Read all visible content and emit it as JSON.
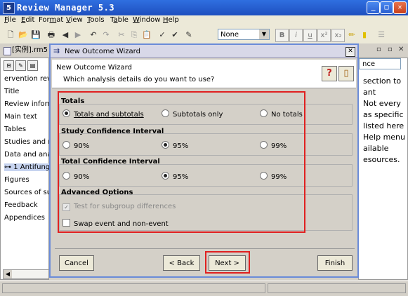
{
  "app": {
    "title": "Review Manager 5.3",
    "icon_text": "5",
    "window_controls": [
      "minimize-icon",
      "maximize-icon",
      "close-icon"
    ]
  },
  "menu": [
    {
      "label": "File",
      "mnemonic": "F"
    },
    {
      "label": "Edit",
      "mnemonic": "E"
    },
    {
      "label": "Format",
      "mnemonic": "m"
    },
    {
      "label": "View",
      "mnemonic": "V"
    },
    {
      "label": "Tools",
      "mnemonic": "T"
    },
    {
      "label": "Table",
      "mnemonic": "a"
    },
    {
      "label": "Window",
      "mnemonic": "W"
    },
    {
      "label": "Help",
      "mnemonic": "H"
    }
  ],
  "toolbar": {
    "style_select": "None",
    "format_buttons": [
      "B",
      "i",
      "u",
      "x²",
      "x₂"
    ]
  },
  "review_window": {
    "tab_label": "[实例].rm5",
    "tree_items": [
      "ervention review",
      "Title",
      "Review inform",
      "Main text",
      "Tables",
      "Studies and re",
      "Data and anal",
      "1 Antifunga",
      "Figures",
      "Sources of sup",
      "Feedback",
      "Appendices"
    ],
    "right_tab": "nce",
    "help_lines": [
      "section to",
      "ant",
      "Not every",
      "as specific",
      "listed here",
      "Help menu",
      "ailable",
      "esources."
    ]
  },
  "dialog": {
    "window_title": "New Outcome Wizard",
    "header_title": "New Outcome Wizard",
    "header_question": "Which analysis details do you want to use?",
    "totals": {
      "label": "Totals",
      "options": [
        {
          "label": "Totals and subtotals",
          "selected": true
        },
        {
          "label": "Subtotals only",
          "selected": false
        },
        {
          "label": "No totals",
          "selected": false
        }
      ]
    },
    "study_ci": {
      "label": "Study Confidence Interval",
      "options": [
        {
          "label": "90%",
          "selected": false
        },
        {
          "label": "95%",
          "selected": true
        },
        {
          "label": "99%",
          "selected": false
        }
      ]
    },
    "total_ci": {
      "label": "Total Confidence Interval",
      "options": [
        {
          "label": "90%",
          "selected": false
        },
        {
          "label": "95%",
          "selected": true
        },
        {
          "label": "99%",
          "selected": false
        }
      ]
    },
    "advanced": {
      "label": "Advanced Options",
      "test_subgroup": {
        "label": "Test for subgroup differences",
        "checked": true,
        "enabled": false
      },
      "swap_event": {
        "label": "Swap event and non-event",
        "checked": false,
        "enabled": true
      }
    },
    "buttons": {
      "cancel": "Cancel",
      "back": "< Back",
      "next": "Next >",
      "finish": "Finish"
    }
  },
  "colors": {
    "highlight_frame": "#e02020",
    "title_bar": "#1e4fbf"
  }
}
